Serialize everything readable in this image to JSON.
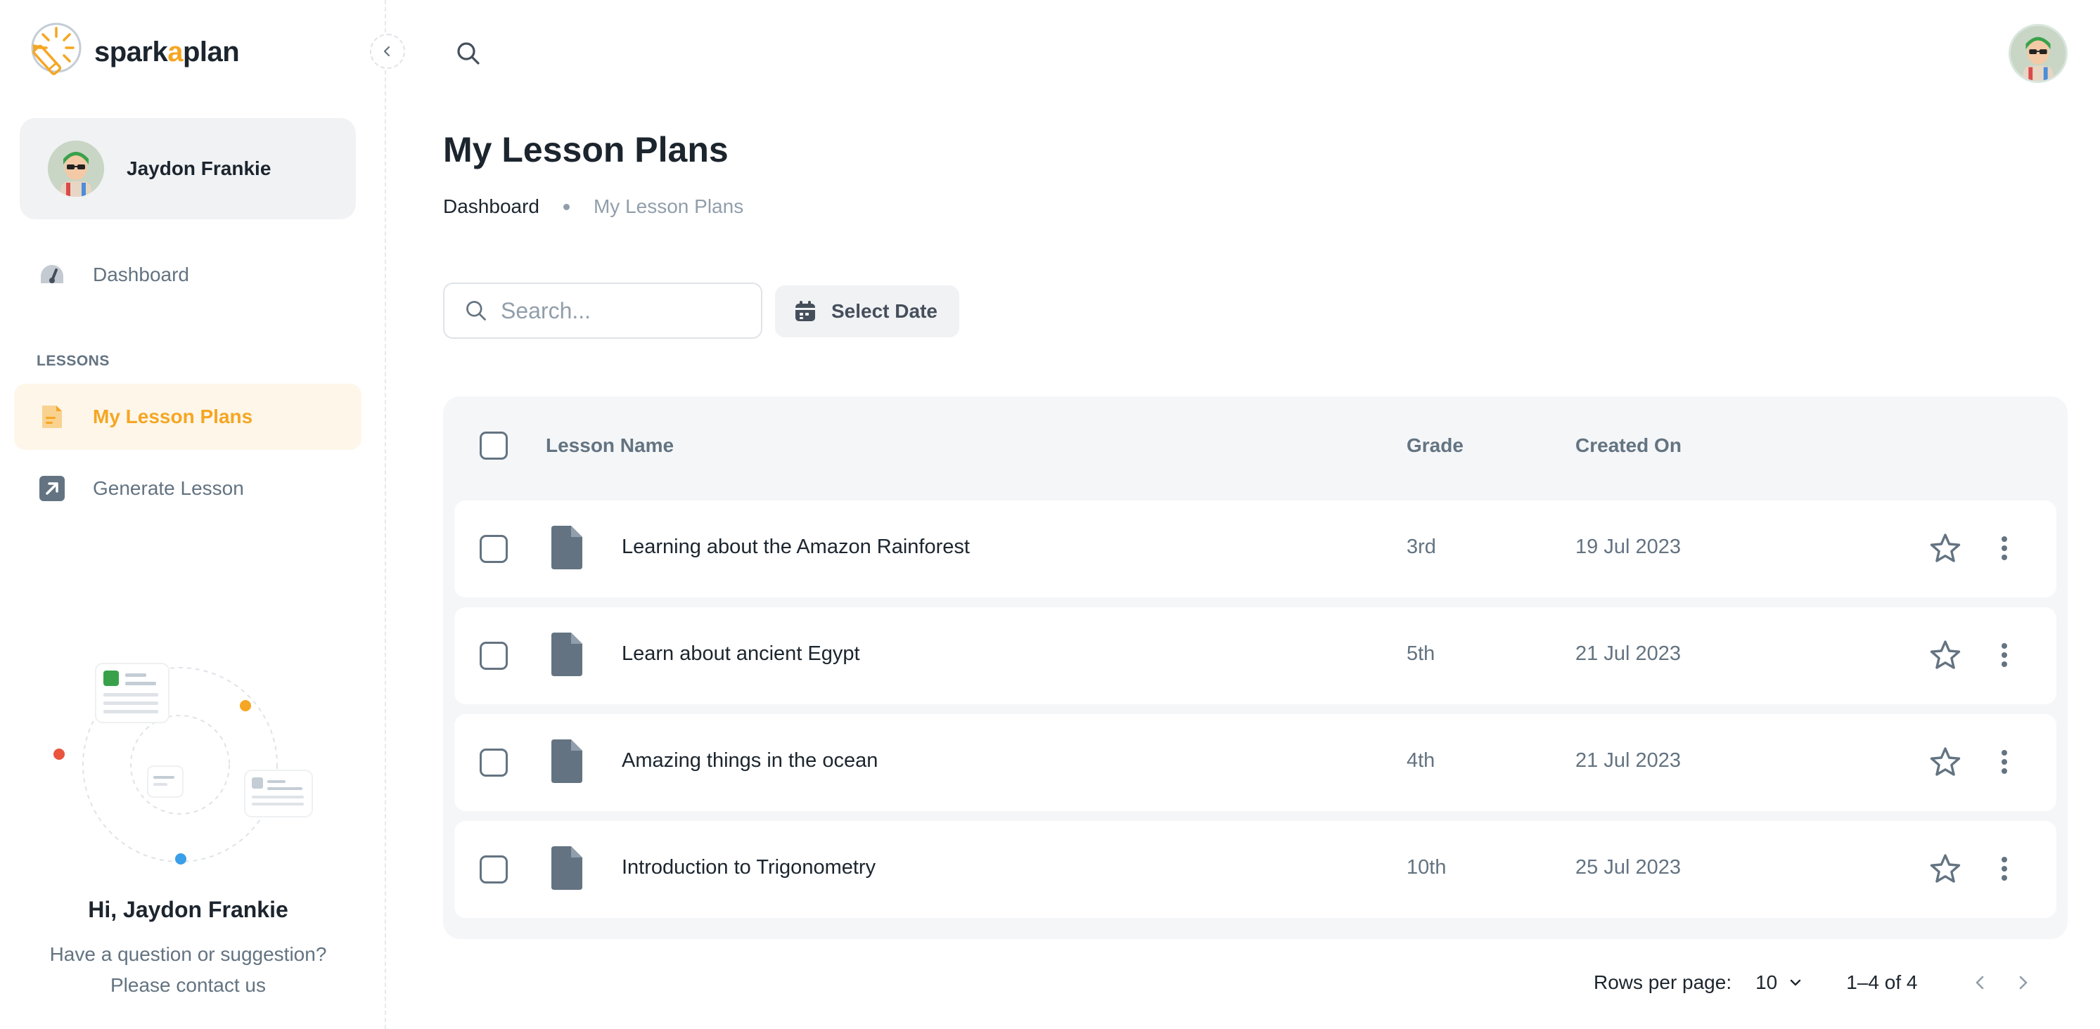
{
  "app": {
    "logo_prefix": "spark",
    "logo_accent": "a",
    "logo_suffix": "plan",
    "brand_color": "#f5a623"
  },
  "sidebar": {
    "account_name": "Jaydon Frankie",
    "nav": [
      {
        "label": "Dashboard",
        "icon": "dashboard-icon",
        "active": false
      },
      {
        "label": "My Lesson Plans",
        "icon": "lesson-plans-icon",
        "active": true
      },
      {
        "label": "Generate Lesson",
        "icon": "generate-icon",
        "active": false
      }
    ],
    "section_label": "LESSONS",
    "help": {
      "title": "Hi, Jaydon Frankie",
      "text": "Have a question or suggestion? Please contact us"
    }
  },
  "header": {
    "search_icon": "search-icon",
    "avatar": "user-avatar"
  },
  "page": {
    "title": "My Lesson Plans",
    "breadcrumb": [
      "Dashboard",
      "My Lesson Plans"
    ]
  },
  "filters": {
    "search_placeholder": "Search...",
    "search_value": "",
    "date_button": "Select Date"
  },
  "table": {
    "columns": [
      "Lesson Name",
      "Grade",
      "Created On"
    ],
    "rows": [
      {
        "name": "Learning about the Amazon Rainforest",
        "grade": "3rd",
        "created": "19 Jul 2023"
      },
      {
        "name": "Learn about ancient Egypt",
        "grade": "5th",
        "created": "21 Jul 2023"
      },
      {
        "name": "Amazing things in the ocean",
        "grade": "4th",
        "created": "21 Jul 2023"
      },
      {
        "name": "Introduction to Trigonometry",
        "grade": "10th",
        "created": "25 Jul 2023"
      }
    ]
  },
  "pagination": {
    "rows_label": "Rows per page:",
    "rows_value": "10",
    "range": "1–4 of 4"
  }
}
